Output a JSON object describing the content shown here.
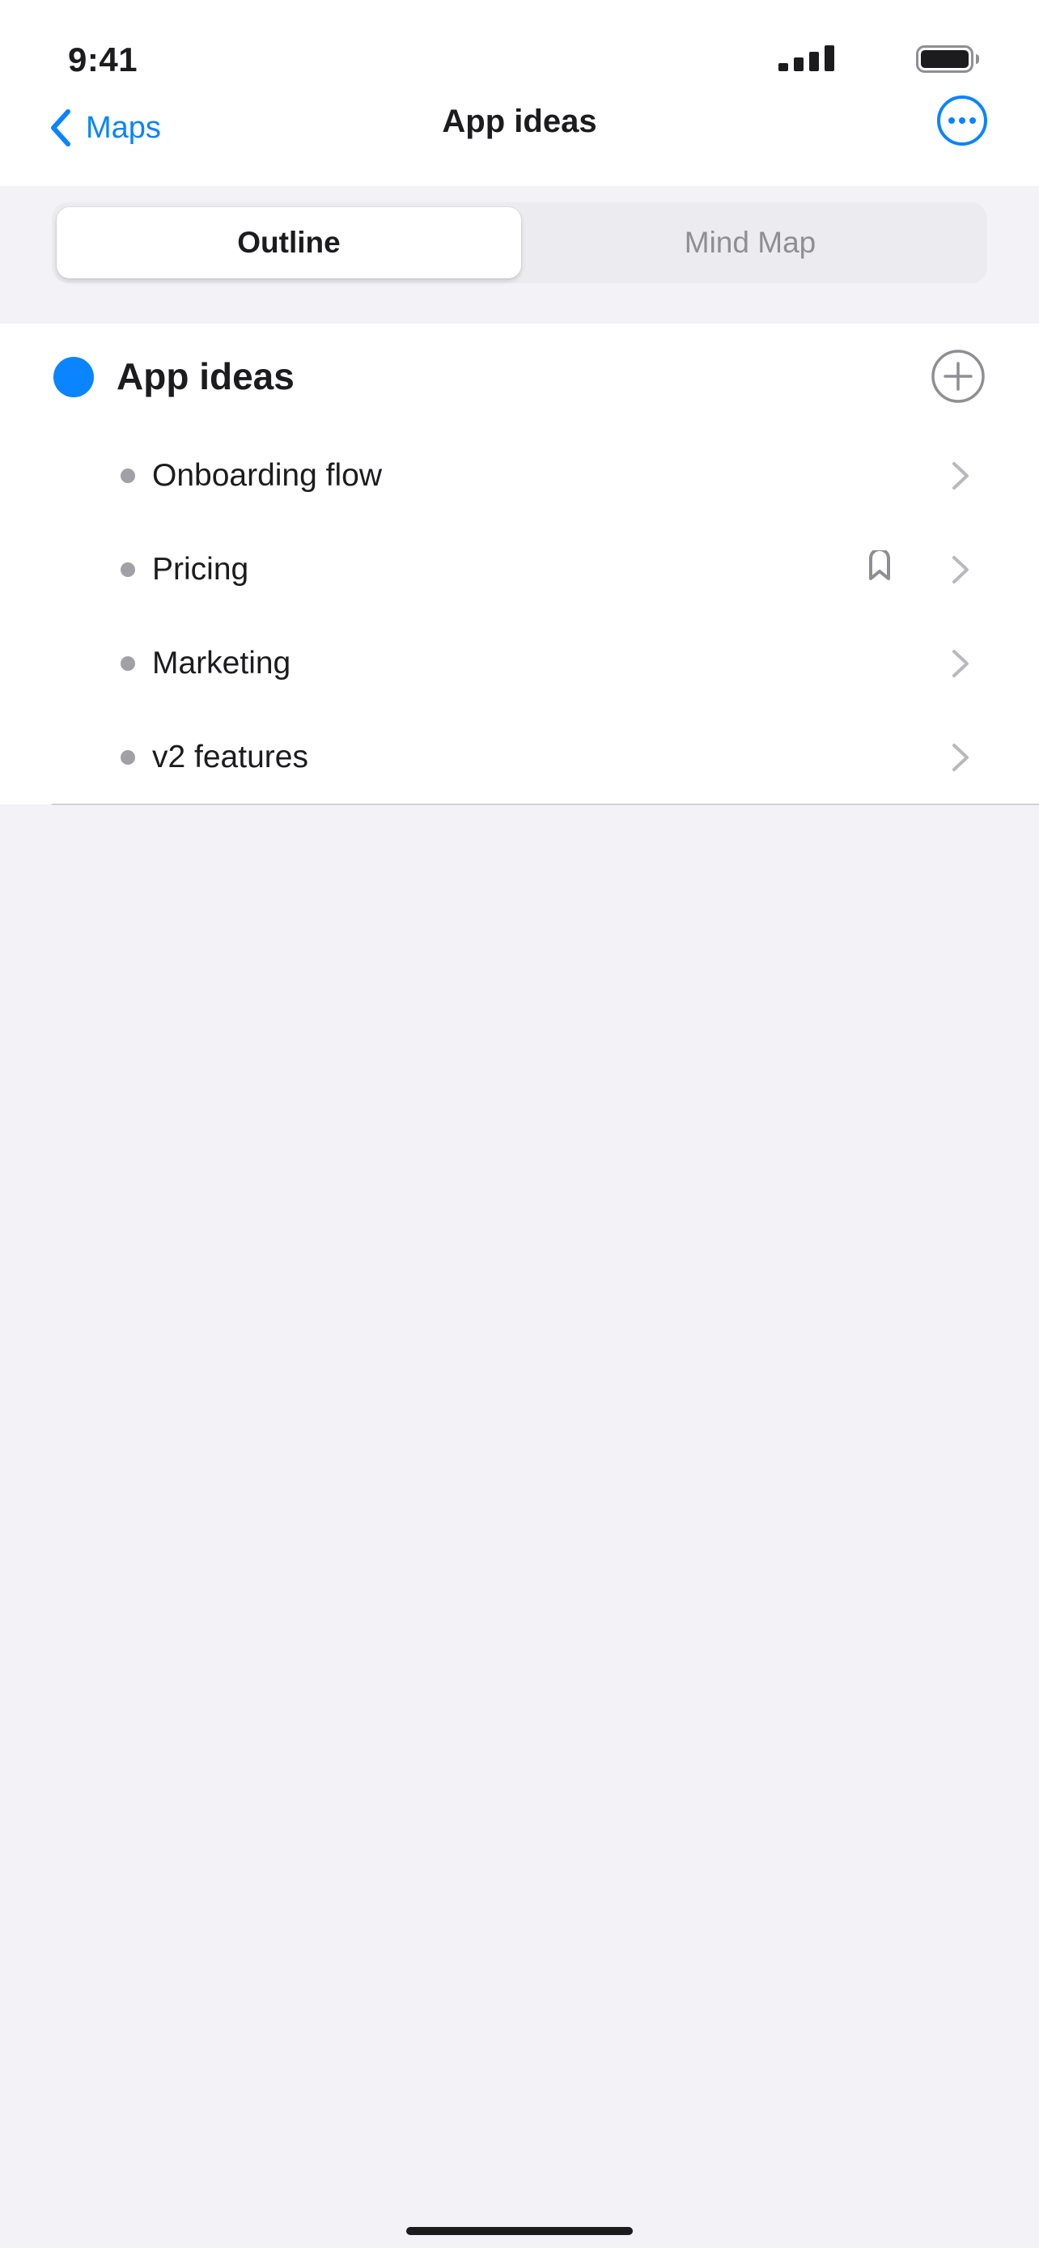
{
  "status_bar": {
    "time": "9:41",
    "signal_icon": "cellular-signal-icon",
    "battery_icon": "battery-icon"
  },
  "nav": {
    "back_label": "Maps",
    "back_icon": "chevron-left-icon",
    "title": "App ideas",
    "more_icon": "ellipsis-circle-icon"
  },
  "segment": {
    "options": [
      "Outline",
      "Mind Map"
    ],
    "selected": "Outline"
  },
  "outline": {
    "root": {
      "title": "App ideas",
      "dot_color": "#0a84ff",
      "add_icon": "plus-circle-icon"
    },
    "children": [
      {
        "label": "Onboarding flow",
        "has_tag": false
      },
      {
        "label": "Pricing",
        "has_tag": true,
        "tag_icon": "bookmark-tag-icon"
      },
      {
        "label": "Marketing",
        "has_tag": false
      },
      {
        "label": "v2 features",
        "has_tag": false
      }
    ]
  },
  "colors": {
    "accent": "#0a84ff",
    "background": "#f2f2f7",
    "surface": "#ffffff",
    "secondary_text": "#8e8e93"
  }
}
